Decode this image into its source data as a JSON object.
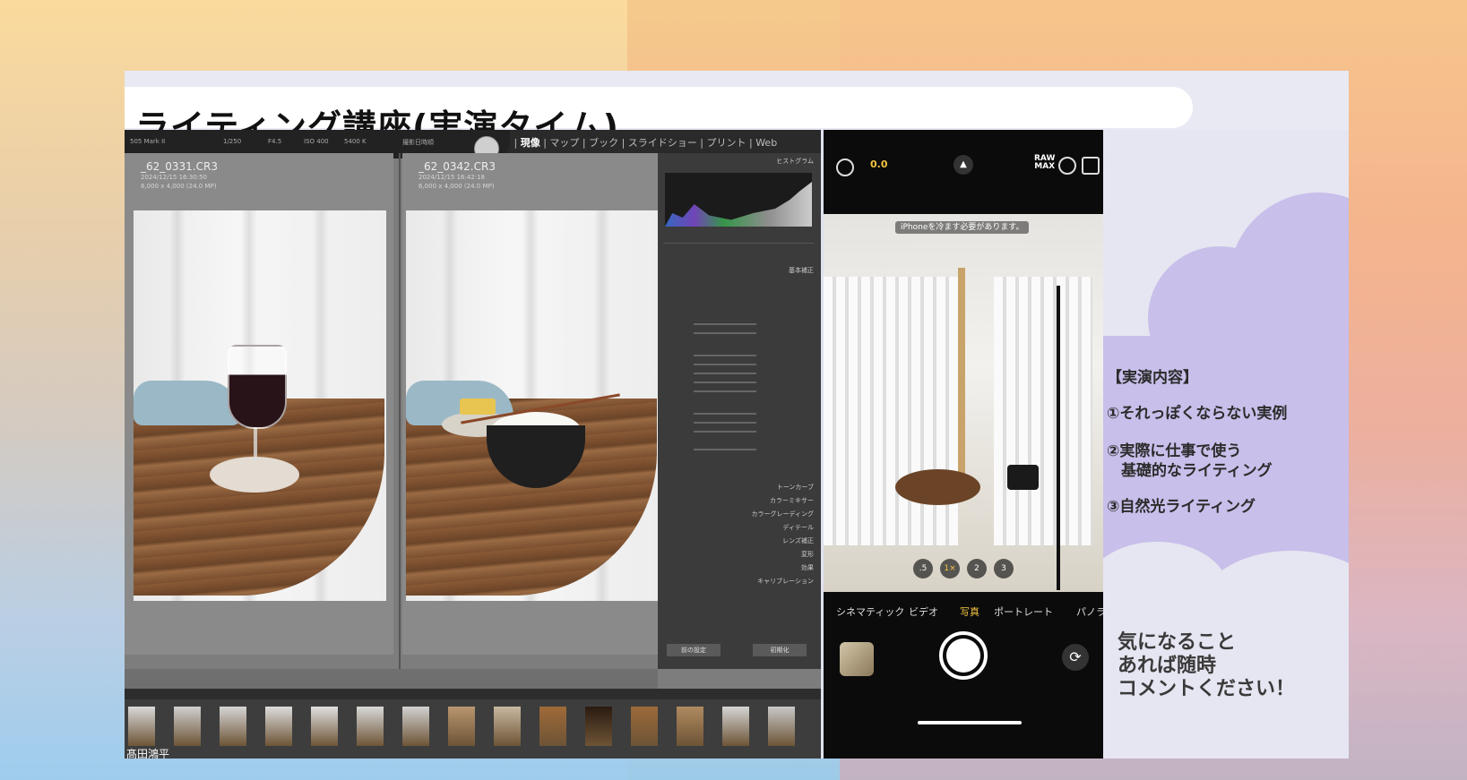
{
  "slide": {
    "title": "ライティング講座(実演タイム)"
  },
  "lightroom": {
    "module_prefix": "り | ",
    "module_active": "現像",
    "module_rest": " | マップ | ブック | スライドショー | プリント | Web",
    "hud_labels": [
      "505 Mark II",
      "1/250",
      "F4.5",
      "ISO 400",
      "5400 K",
      "撮影日時順"
    ],
    "left_photo": {
      "filename": "_62_0331.CR3",
      "meta_line1": "2024/12/15 16:30:50",
      "meta_line2": "6,000 x 4,000 (24.0 MP)"
    },
    "right_photo": {
      "filename": "_62_0342.CR3",
      "meta_line1": "2024/12/15 16:42:18",
      "meta_line2": "6,000 x 4,000 (24.0 MP)"
    },
    "right_panel": {
      "histogram_title": "ヒストグラム",
      "basic_title": "基本補正",
      "sections": [
        "トーンカーブ",
        "カラーミキサー",
        "カラーグレーディング",
        "ディテール",
        "レンズ補正",
        "変形",
        "効果",
        "キャリブレーション"
      ],
      "buttons": [
        "前の設定",
        "初期化"
      ]
    },
    "speaker_name": "髙田鴻平",
    "filmstrip_tones": [
      "#d9d9d9",
      "#cfcfcf",
      "#d5d5d5",
      "#dcdcdc",
      "#e0e0e0",
      "#d8d8d8",
      "#d1d1d1",
      "#b89670",
      "#c8b8a0",
      "#a06a38",
      "#2a1a10",
      "#9c6a3a",
      "#b08a60",
      "#d4d4d4",
      "#c8c8c8"
    ]
  },
  "iphone": {
    "exposure": "0.0",
    "raw_label": "RAW",
    "raw_sub": "MAX",
    "warning": "iPhoneを冷ます必要があります。",
    "zoom_levels": [
      ".5",
      "1×",
      "2",
      "3"
    ],
    "modes": [
      "シネマティック",
      "ビデオ",
      "写真",
      "ポートレート",
      "パノラマ"
    ],
    "active_mode": "写真"
  },
  "info": {
    "heading": "【実演内容】",
    "item1": "①それっぽくならない実例",
    "item2_line1": "②実際に仕事で使う",
    "item2_line2": "基礎的なライティング",
    "item3": "③自然光ライティング",
    "comment_line1": "気になること",
    "comment_line2": "あれば随時",
    "comment_line3": "コメントください！"
  },
  "colors": {
    "accent_yellow": "#f5c542",
    "cloud_purple": "#c8bfea",
    "slide_bg": "#dfe1ee"
  }
}
